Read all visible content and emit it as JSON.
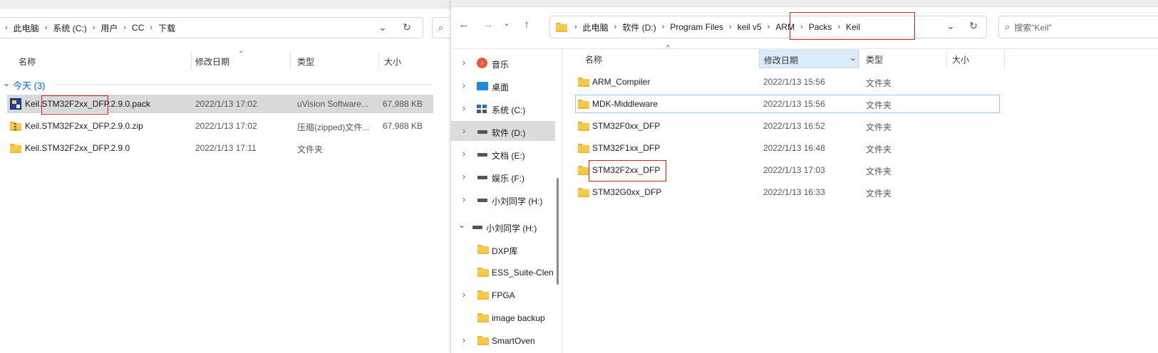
{
  "left_window": {
    "breadcrumb": [
      "此电脑",
      "系统 (C:)",
      "用户",
      "CC",
      "下载"
    ],
    "columns": {
      "name": "名称",
      "date": "修改日期",
      "type": "类型",
      "size": "大小"
    },
    "group_label": "今天 (3)",
    "files": [
      {
        "name": "Keil.STM32F2xx_DFP.2.9.0.pack",
        "date": "2022/1/13 17:02",
        "type": "uVision Software...",
        "size": "67,988 KB",
        "icon": "pack-file-icon"
      },
      {
        "name": "Keil.STM32F2xx_DFP.2.9.0.zip",
        "date": "2022/1/13 17:02",
        "type": "压缩(zipped)文件...",
        "size": "67,988 KB",
        "icon": "zip-folder-icon"
      },
      {
        "name": "Keil.STM32F2xx_DFP.2.9.0",
        "date": "2022/1/13 17:11",
        "type": "文件夹",
        "size": "",
        "icon": "folder-icon"
      }
    ]
  },
  "right_window": {
    "breadcrumb": [
      "此电脑",
      "软件 (D:)",
      "Program Files",
      "keil v5",
      "ARM",
      "Packs",
      "Keil"
    ],
    "search_placeholder": "搜索\"Keil\"",
    "columns": {
      "name": "名称",
      "date": "修改日期",
      "type": "类型",
      "size": "大小"
    },
    "nav_tree": [
      {
        "label": "音乐",
        "icon": "music-icon",
        "expander": "›"
      },
      {
        "label": "桌面",
        "icon": "desktop-icon",
        "expander": "›"
      },
      {
        "label": "系统 (C:)",
        "icon": "windows-drive-icon",
        "expander": "›"
      },
      {
        "label": "软件 (D:)",
        "icon": "drive-icon",
        "expander": "›",
        "selected": true
      },
      {
        "label": "文档 (E:)",
        "icon": "drive-icon",
        "expander": "›"
      },
      {
        "label": "娱乐 (F:)",
        "icon": "drive-icon",
        "expander": "›"
      },
      {
        "label": "小刘同学 (H:)",
        "icon": "drive-icon",
        "expander": "›"
      },
      {
        "label": "小刘同学 (H:)",
        "icon": "drive-icon",
        "expander": "⌄"
      },
      {
        "label": "DXP库",
        "icon": "folder-icon",
        "expander": ""
      },
      {
        "label": "ESS_Suite-Clen",
        "icon": "folder-icon",
        "expander": ""
      },
      {
        "label": "FPGA",
        "icon": "folder-icon",
        "expander": "›"
      },
      {
        "label": "image backup",
        "icon": "folder-icon",
        "expander": ""
      },
      {
        "label": "SmartOven",
        "icon": "folder-icon",
        "expander": "›"
      }
    ],
    "files": [
      {
        "name": "ARM_Compiler",
        "date": "2022/1/13 15:56",
        "type": "文件夹"
      },
      {
        "name": "MDK-Middleware",
        "date": "2022/1/13 15:56",
        "type": "文件夹"
      },
      {
        "name": "STM32F0xx_DFP",
        "date": "2022/1/13 16:52",
        "type": "文件夹"
      },
      {
        "name": "STM32F1xx_DFP",
        "date": "2022/1/13 16:48",
        "type": "文件夹"
      },
      {
        "name": "STM32F2xx_DFP",
        "date": "2022/1/13 17:03",
        "type": "文件夹"
      },
      {
        "name": "STM32G0xx_DFP",
        "date": "2022/1/13 16:33",
        "type": "文件夹"
      }
    ]
  },
  "colors": {
    "accent": "#0067c0",
    "selection": "#cce8ff",
    "highlight_box": "#e01b1b",
    "folder": "#f7c948"
  }
}
